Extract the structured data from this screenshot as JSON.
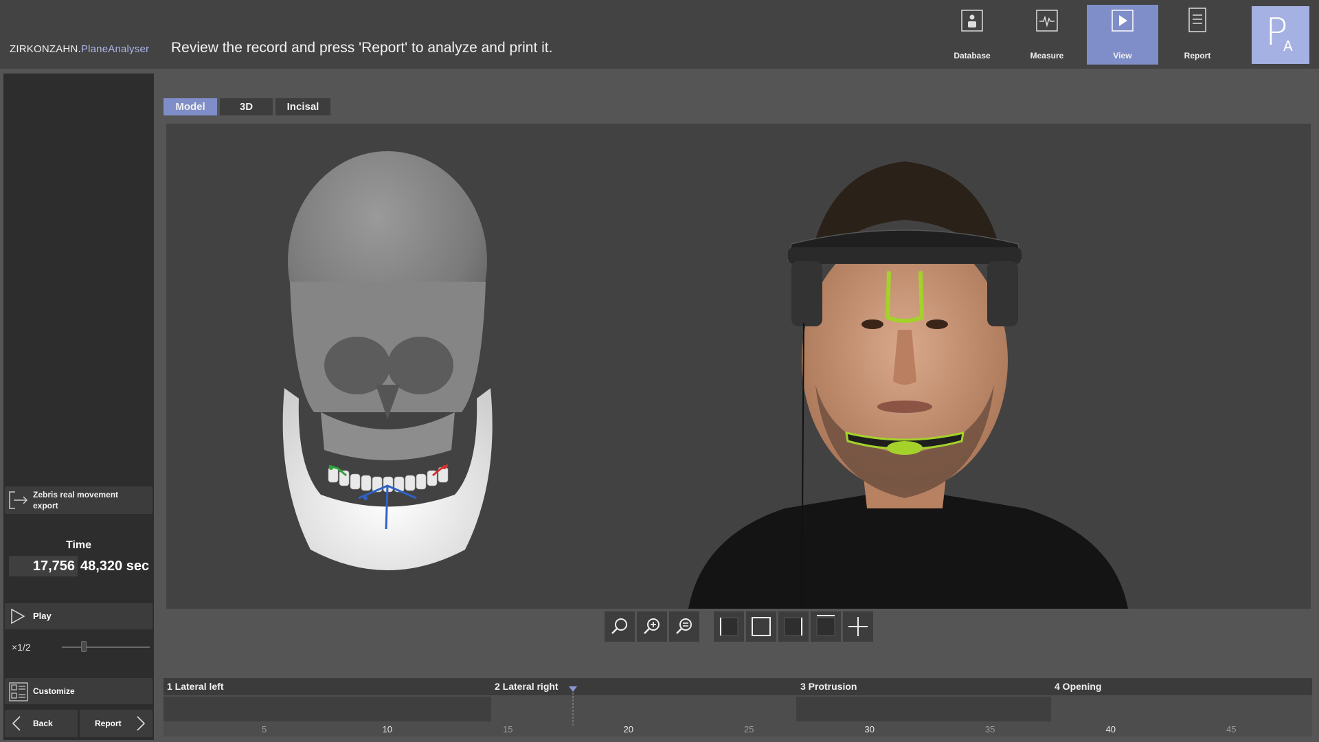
{
  "app": {
    "brand_main": "ZIRKONZAHN.",
    "brand_sub": "PlaneAnalyser",
    "instruction": "Review the record and press 'Report' to analyze and print it."
  },
  "nav": [
    {
      "label": "Database",
      "icon": "database-icon"
    },
    {
      "label": "Measure",
      "icon": "measure-icon"
    },
    {
      "label": "View",
      "icon": "view-icon",
      "active": true
    },
    {
      "label": "Report",
      "icon": "report-icon"
    }
  ],
  "logo": {
    "p": "P",
    "a": "A"
  },
  "colors": {
    "accent": "#7f8ec8",
    "logo_bg": "#a5b1e2",
    "header_bg": "#434344",
    "sidebar_bg": "#2d2d2e"
  },
  "sidebar": {
    "export_label": "Zebris real movement export",
    "time_title": "Time",
    "time_current": "17,756",
    "time_total": "48,320 sec",
    "play_label": "Play",
    "speed_label": "×1/2",
    "speed_level": 0.25,
    "customize_label": "Customize",
    "back_label": "Back",
    "report_label": "Report"
  },
  "view_tabs": [
    {
      "label": "Model",
      "active": true
    },
    {
      "label": "3D",
      "active": false
    },
    {
      "label": "Incisal",
      "active": false
    }
  ],
  "tools": [
    "zoom-out-icon",
    "zoom-in-icon",
    "zoom-fit-icon",
    "view-left-icon",
    "view-front-icon",
    "view-right-icon",
    "view-top-icon",
    "crosshair-icon"
  ],
  "timeline": {
    "segments": [
      {
        "label": "1 Lateral left"
      },
      {
        "label": "2 Lateral right"
      },
      {
        "label": "3 Protrusion"
      },
      {
        "label": "4 Opening"
      }
    ],
    "ticks": [
      "5",
      "10",
      "15",
      "20",
      "25",
      "30",
      "35",
      "40",
      "45"
    ],
    "marker_time": 17.756
  }
}
